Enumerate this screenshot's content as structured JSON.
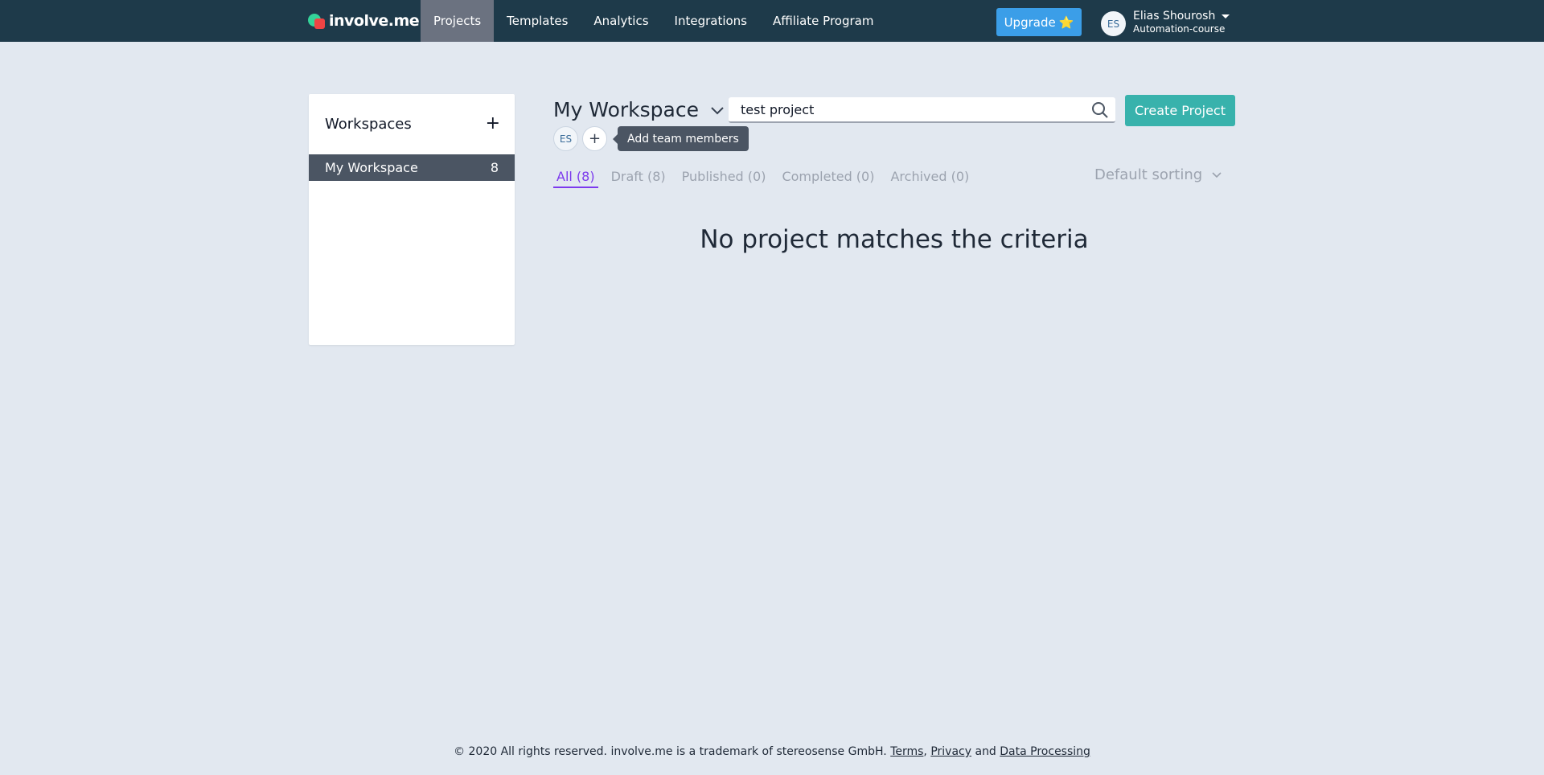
{
  "brand": {
    "name": "involve.me"
  },
  "nav": {
    "items": [
      {
        "label": "Projects",
        "active": true
      },
      {
        "label": "Templates",
        "active": false
      },
      {
        "label": "Analytics",
        "active": false
      },
      {
        "label": "Integrations",
        "active": false
      },
      {
        "label": "Affiliate Program",
        "active": false
      }
    ],
    "upgrade_label": "Upgrade",
    "upgrade_icon": "⭐"
  },
  "user": {
    "initials": "ES",
    "name": "Elias Shourosh",
    "org": "Automation-course"
  },
  "workspaces": {
    "title": "Workspaces",
    "add_icon": "+",
    "items": [
      {
        "name": "My Workspace",
        "count": "8",
        "active": true
      }
    ]
  },
  "main": {
    "workspace_name": "My Workspace",
    "search": {
      "value": "test project",
      "placeholder": ""
    },
    "create_label": "Create Project",
    "members": [
      {
        "initials": "ES"
      }
    ],
    "add_member_icon": "+",
    "tooltip": "Add team members",
    "tabs": [
      {
        "label": "All (8)",
        "active": true
      },
      {
        "label": "Draft (8)",
        "active": false
      },
      {
        "label": "Published (0)",
        "active": false
      },
      {
        "label": "Completed (0)",
        "active": false
      },
      {
        "label": "Archived (0)",
        "active": false
      }
    ],
    "sorting_label": "Default sorting",
    "empty_message": "No project matches the criteria"
  },
  "footer": {
    "text": "© 2020 All rights reserved. involve.me is a trademark of stereosense GmbH.",
    "terms": "Terms",
    "sep": ",",
    "privacy": "Privacy",
    "and": "and",
    "data_processing": "Data Processing"
  },
  "colors": {
    "topbar": "#1e3a4a",
    "accent_purple": "#7c3aed",
    "create_teal": "#38b2ac",
    "upgrade_blue": "#3b9ee8"
  }
}
